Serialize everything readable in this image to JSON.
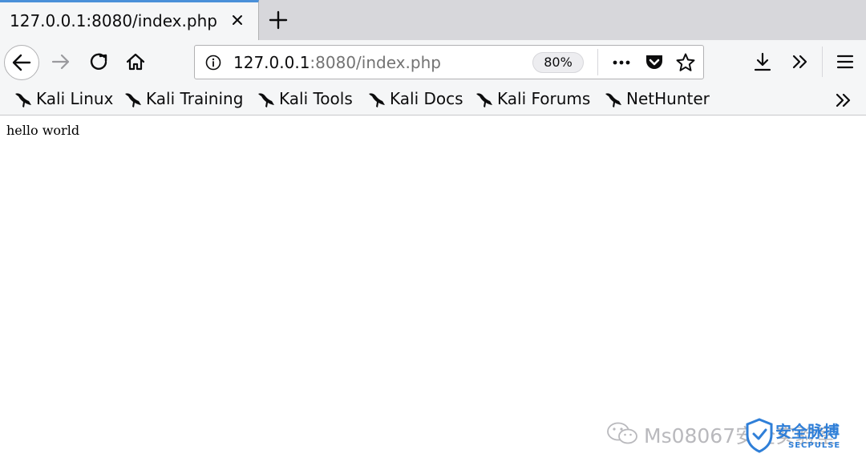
{
  "tab": {
    "title": "127.0.0.1:8080/index.php"
  },
  "urlbar": {
    "host": "127.0.0.1",
    "path": ":8080/index.php",
    "zoom": "80%"
  },
  "bookmarks": [
    {
      "label": "Kali Linux"
    },
    {
      "label": "Kali Training"
    },
    {
      "label": "Kali Tools"
    },
    {
      "label": "Kali Docs"
    },
    {
      "label": "Kali Forums"
    },
    {
      "label": "NetHunter"
    }
  ],
  "page": {
    "body_text": "hello world"
  },
  "watermark": {
    "text": "Ms08067安全实验室",
    "logo_title": "安全脉搏",
    "logo_sub": "SECPULSE"
  },
  "icons": {
    "tab_close": "close-icon",
    "new_tab": "plus-icon",
    "back": "back-arrow-icon",
    "forward": "forward-arrow-icon",
    "reload": "reload-icon",
    "home": "home-icon",
    "site_info": "info-icon",
    "page_actions": "more-icon",
    "pocket": "pocket-icon",
    "bookmark_star": "star-icon",
    "downloads": "download-icon",
    "overflow": "chevron-double-right-icon",
    "menu": "hamburger-menu-icon",
    "bookmark_favicon": "kali-dragon-icon"
  },
  "colors": {
    "tab_accent": "#4a90d9",
    "chrome_bg": "#f5f6f7",
    "tabstrip_bg": "#d7d7db",
    "watermark_logo": "#2f7fd8"
  }
}
